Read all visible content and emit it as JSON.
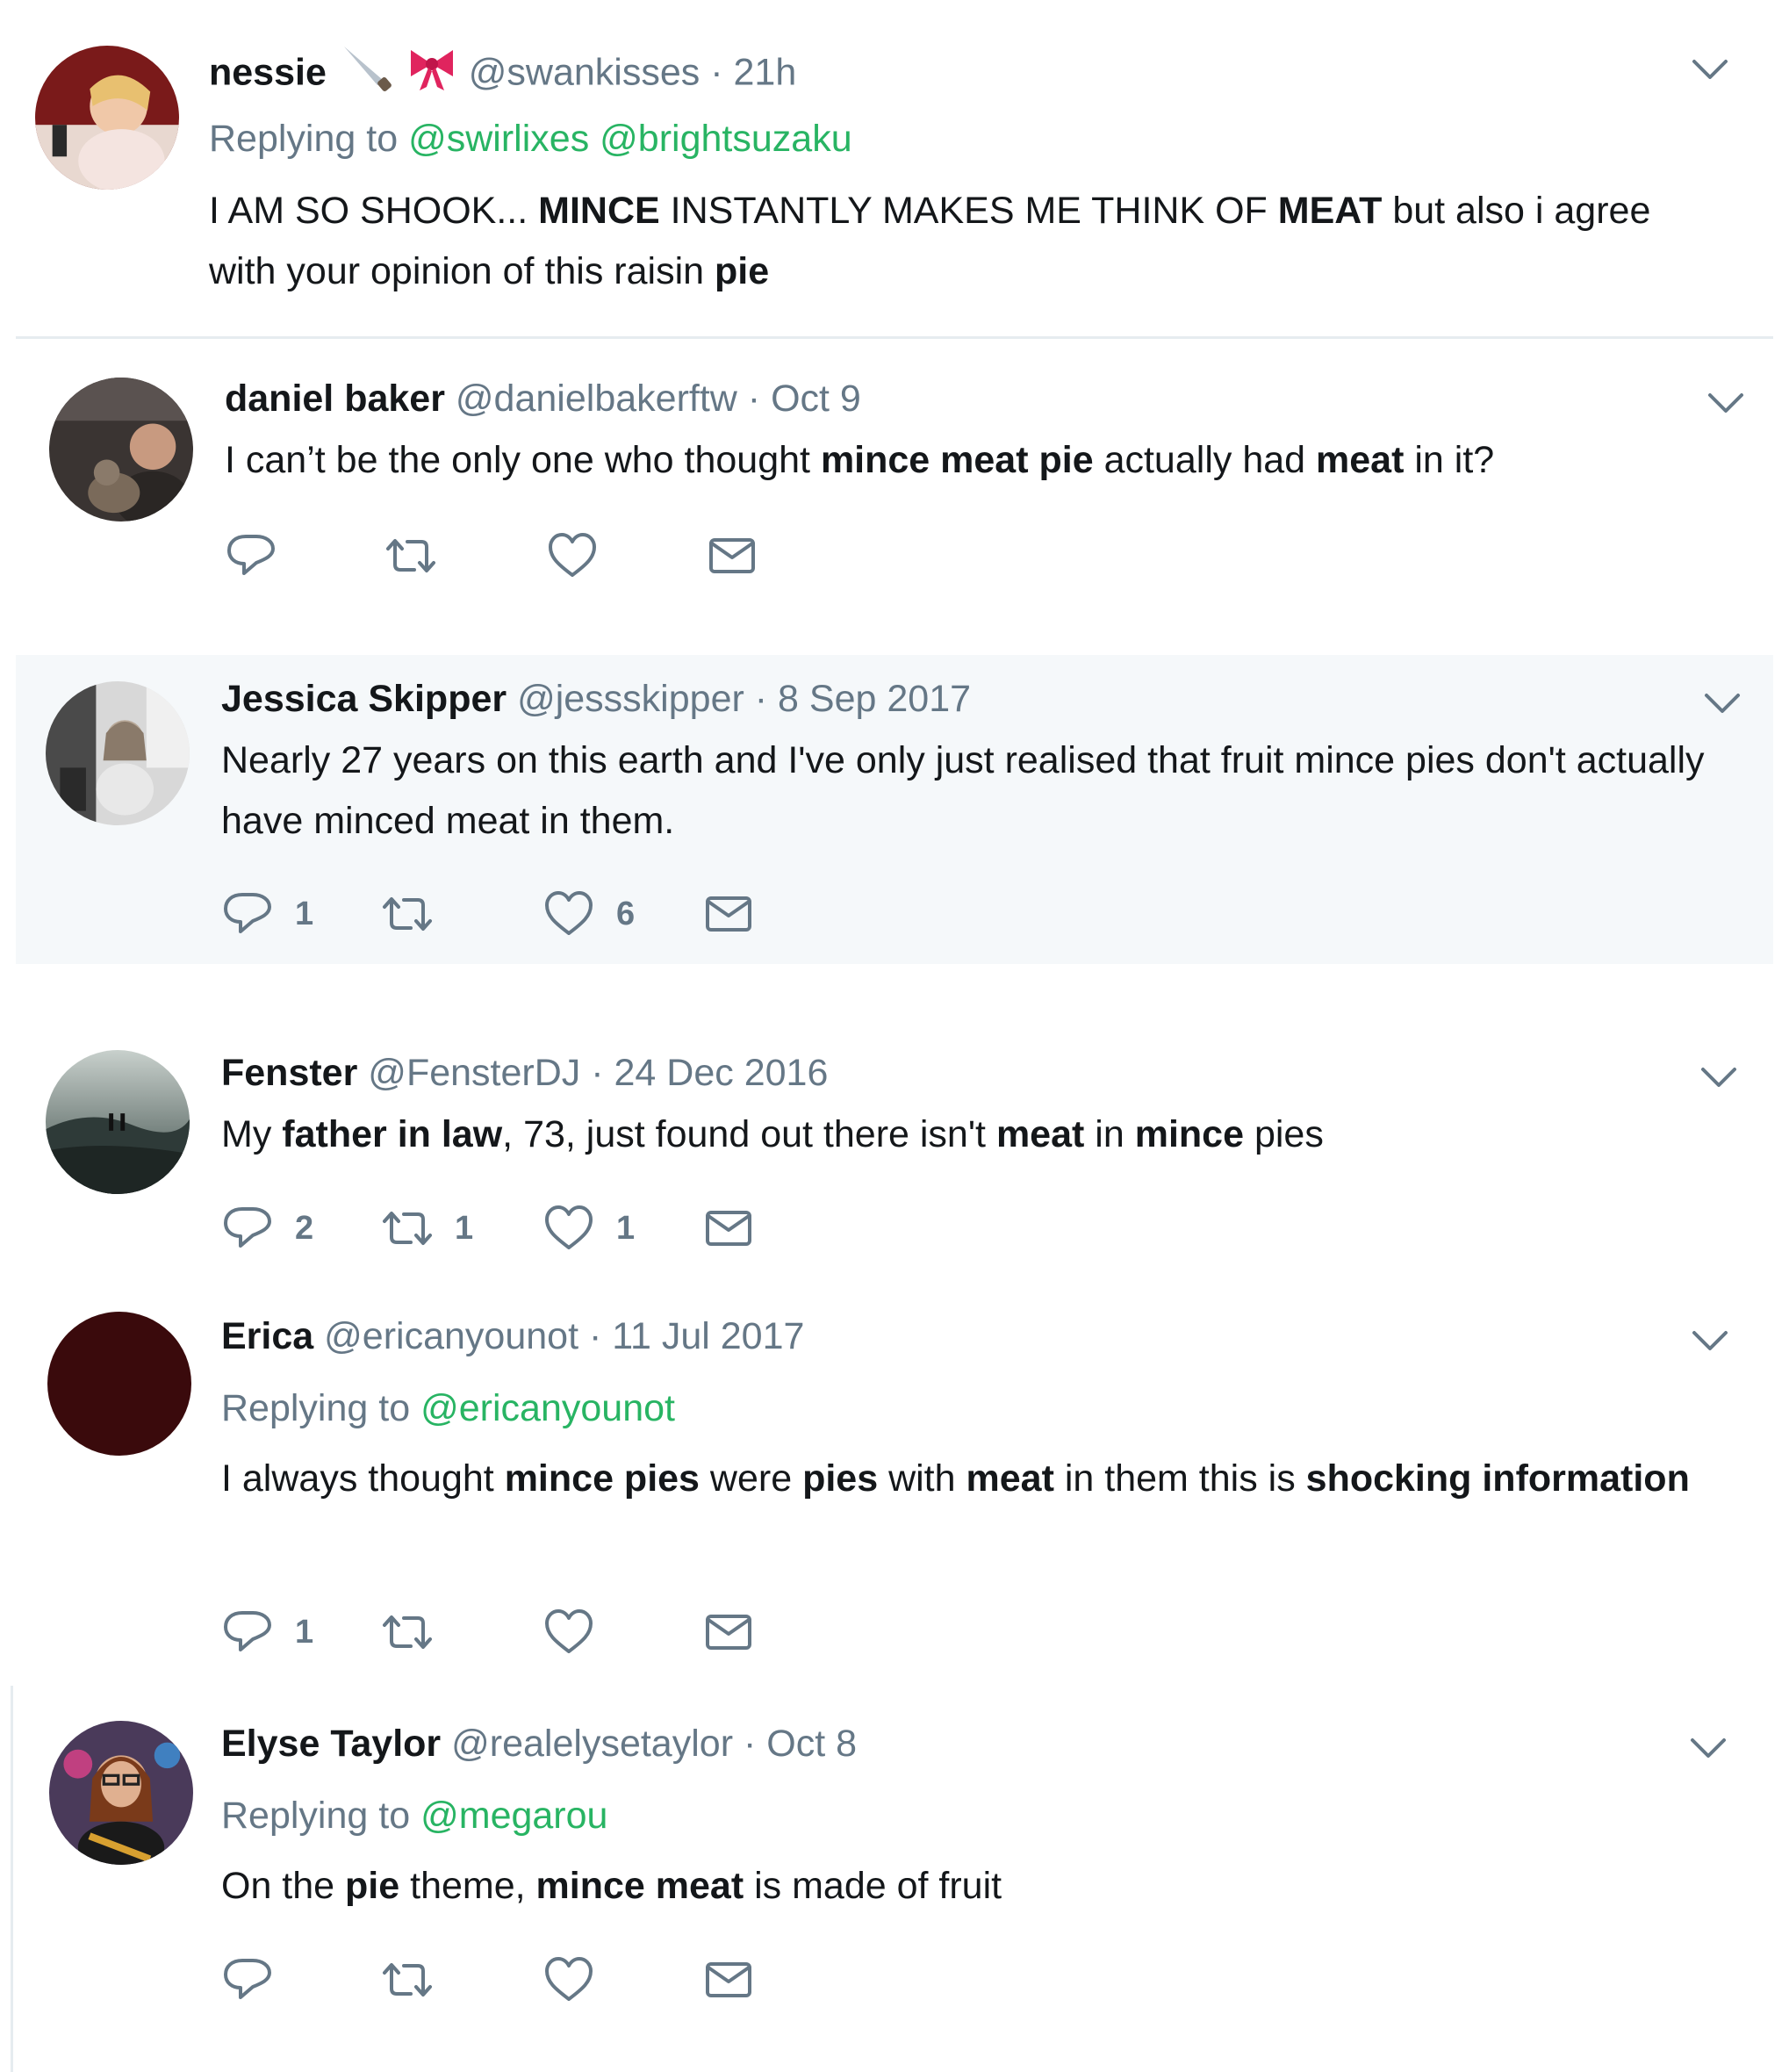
{
  "tweets": [
    {
      "name": "nessie",
      "handle": "@swankisses",
      "sep": "·",
      "time": "21h",
      "replying_label": "Replying to",
      "replying_to": [
        "@swirlixes",
        "@brightsuzaku"
      ],
      "text_parts": [
        {
          "t": "I AM SO SHOOK... ",
          "b": false
        },
        {
          "t": "MINCE",
          "b": true
        },
        {
          "t": " INSTANTLY MAKES ME THINK OF ",
          "b": false
        },
        {
          "t": "MEAT",
          "b": true
        },
        {
          "t": " but also i agree with your opinion of this raisin ",
          "b": false
        },
        {
          "t": "pie",
          "b": true
        }
      ]
    },
    {
      "name": "daniel baker",
      "handle": "@danielbakerftw",
      "sep": "·",
      "time": "Oct 9",
      "text_parts": [
        {
          "t": "I can’t be the only one who thought ",
          "b": false
        },
        {
          "t": "mince meat pie",
          "b": true
        },
        {
          "t": " actually had ",
          "b": false
        },
        {
          "t": "meat",
          "b": true
        },
        {
          "t": " in it?",
          "b": false
        }
      ],
      "counts": {
        "reply": "",
        "retweet": "",
        "like": ""
      }
    },
    {
      "name": "Jessica Skipper",
      "handle": "@jessskipper",
      "sep": "·",
      "time": "8 Sep 2017",
      "text_parts": [
        {
          "t": "Nearly 27 years on this earth and I've only just realised that fruit mince pies don't actually have minced meat in them.",
          "b": false
        }
      ],
      "counts": {
        "reply": "1",
        "retweet": "",
        "like": "6"
      }
    },
    {
      "name": "Fenster",
      "handle": "@FensterDJ",
      "sep": "·",
      "time": "24 Dec 2016",
      "text_parts": [
        {
          "t": "My ",
          "b": false
        },
        {
          "t": "father in law",
          "b": true
        },
        {
          "t": ", 73, just found out there isn't ",
          "b": false
        },
        {
          "t": "meat",
          "b": true
        },
        {
          "t": " in ",
          "b": false
        },
        {
          "t": "mince",
          "b": true
        },
        {
          "t": " pies",
          "b": false
        }
      ],
      "counts": {
        "reply": "2",
        "retweet": "1",
        "like": "1"
      }
    },
    {
      "name": "Erica",
      "handle": "@ericanyounot",
      "sep": "·",
      "time": "11 Jul 2017",
      "replying_label": "Replying to",
      "replying_to": [
        "@ericanyounot"
      ],
      "text_parts": [
        {
          "t": "I always thought ",
          "b": false
        },
        {
          "t": "mince pies",
          "b": true
        },
        {
          "t": " were ",
          "b": false
        },
        {
          "t": "pies",
          "b": true
        },
        {
          "t": " with ",
          "b": false
        },
        {
          "t": "meat",
          "b": true
        },
        {
          "t": " in them this is ",
          "b": false
        },
        {
          "t": "shocking information",
          "b": true
        }
      ],
      "counts": {
        "reply": "1",
        "retweet": "",
        "like": ""
      }
    },
    {
      "name": "Elyse Taylor",
      "handle": "@realelysetaylor",
      "sep": "·",
      "time": "Oct 8",
      "replying_label": "Replying to",
      "replying_to": [
        "@megarou"
      ],
      "text_parts": [
        {
          "t": "On the ",
          "b": false
        },
        {
          "t": "pie",
          "b": true
        },
        {
          "t": " theme, ",
          "b": false
        },
        {
          "t": "mince meat",
          "b": true
        },
        {
          "t": " is made of fruit",
          "b": false
        }
      ],
      "counts": {
        "reply": "",
        "retweet": "",
        "like": ""
      }
    }
  ],
  "icons": {
    "reply": "reply-icon",
    "retweet": "retweet-icon",
    "like": "heart-icon",
    "dm": "mail-icon",
    "caret": "chevron-down-icon"
  },
  "colors": {
    "name": "#14171a",
    "meta": "#657786",
    "mention": "#28b463",
    "highlight_bg": "#f5f8fa",
    "divider": "#e6ecf0"
  }
}
